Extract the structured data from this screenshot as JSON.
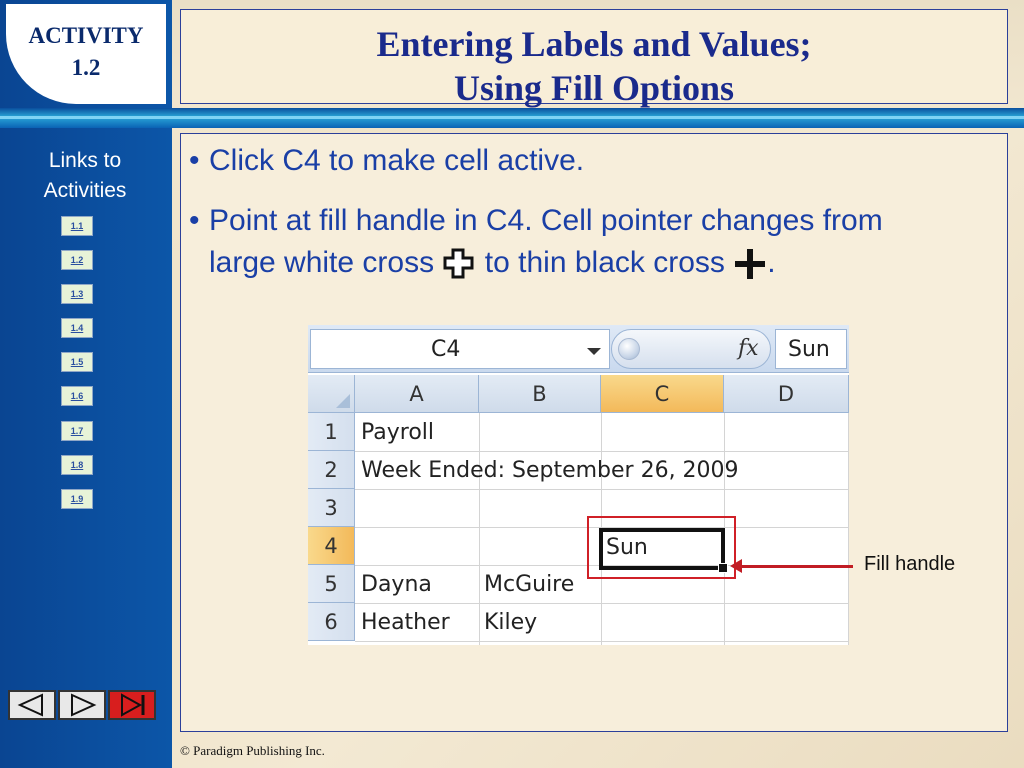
{
  "activity": {
    "line1": "ACTIVITY",
    "line2": "1.2"
  },
  "title": {
    "line1": "Entering Labels and Values;",
    "line2": "Using Fill Options"
  },
  "links": {
    "title": "Links to Activities",
    "items": [
      "1.1",
      "1.2",
      "1.3",
      "1.4",
      "1.5",
      "1.6",
      "1.7",
      "1.8",
      "1.9"
    ]
  },
  "bullets": {
    "b1": "Click C4 to make cell active.",
    "b2_part1": "Point at fill handle in C4. Cell pointer changes from",
    "b2_part2a": "large white cross",
    "b2_part2b": "to thin black cross",
    "b2_end": "."
  },
  "spreadsheet": {
    "name_box": "C4",
    "formula_symbol": "fx",
    "formula_value": "Sun",
    "columns": [
      "A",
      "B",
      "C",
      "D"
    ],
    "rows": [
      "1",
      "2",
      "3",
      "4",
      "5",
      "6"
    ],
    "cells": {
      "A1": "Payroll",
      "A2": "Week Ended: September 26, 2009",
      "C4": "Sun",
      "A5": "Dayna",
      "B5": "McGuire",
      "A6": "Heather",
      "B6": "Kiley"
    }
  },
  "callout": {
    "label": "Fill handle"
  },
  "footer": "© Paradigm Publishing Inc.",
  "colors": {
    "sidebar": "#0a4f9e",
    "title_text": "#1a2a8c",
    "bullet_text": "#1a3fa6",
    "highlight": "#d02027"
  },
  "icons": [
    "white-cross-icon",
    "black-cross-icon",
    "prev-slide-icon",
    "next-slide-icon",
    "last-slide-icon"
  ]
}
